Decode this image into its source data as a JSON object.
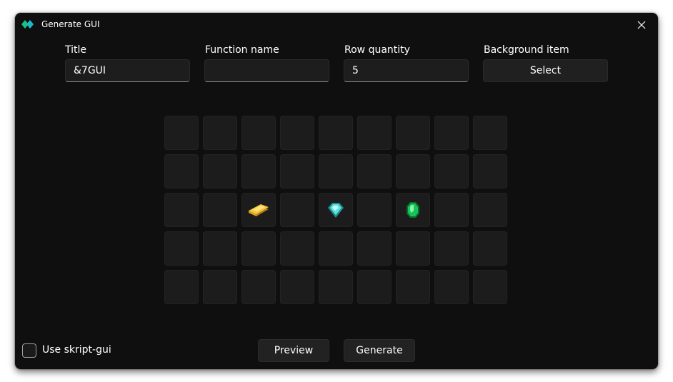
{
  "window": {
    "title": "Generate GUI"
  },
  "fields": {
    "title": {
      "label": "Title",
      "value": "&7GUI"
    },
    "function_name": {
      "label": "Function name",
      "value": ""
    },
    "row_quantity": {
      "label": "Row quantity",
      "value": "5"
    },
    "background_item": {
      "label": "Background item",
      "button_label": "Select"
    }
  },
  "grid": {
    "columns": 9,
    "rows": 5,
    "items": [
      {
        "row": 3,
        "col": 3,
        "icon": "gold-ingot-icon"
      },
      {
        "row": 3,
        "col": 5,
        "icon": "diamond-icon"
      },
      {
        "row": 3,
        "col": 7,
        "icon": "emerald-icon"
      }
    ]
  },
  "footer": {
    "checkbox_label": "Use skript-gui",
    "checkbox_checked": false,
    "preview_label": "Preview",
    "generate_label": "Generate"
  },
  "colors": {
    "accent_green": "#19c37d",
    "accent_cyan": "#20b8c8",
    "gold": "#f5c542",
    "diamond": "#5ee2e0",
    "emerald": "#17c45a"
  }
}
